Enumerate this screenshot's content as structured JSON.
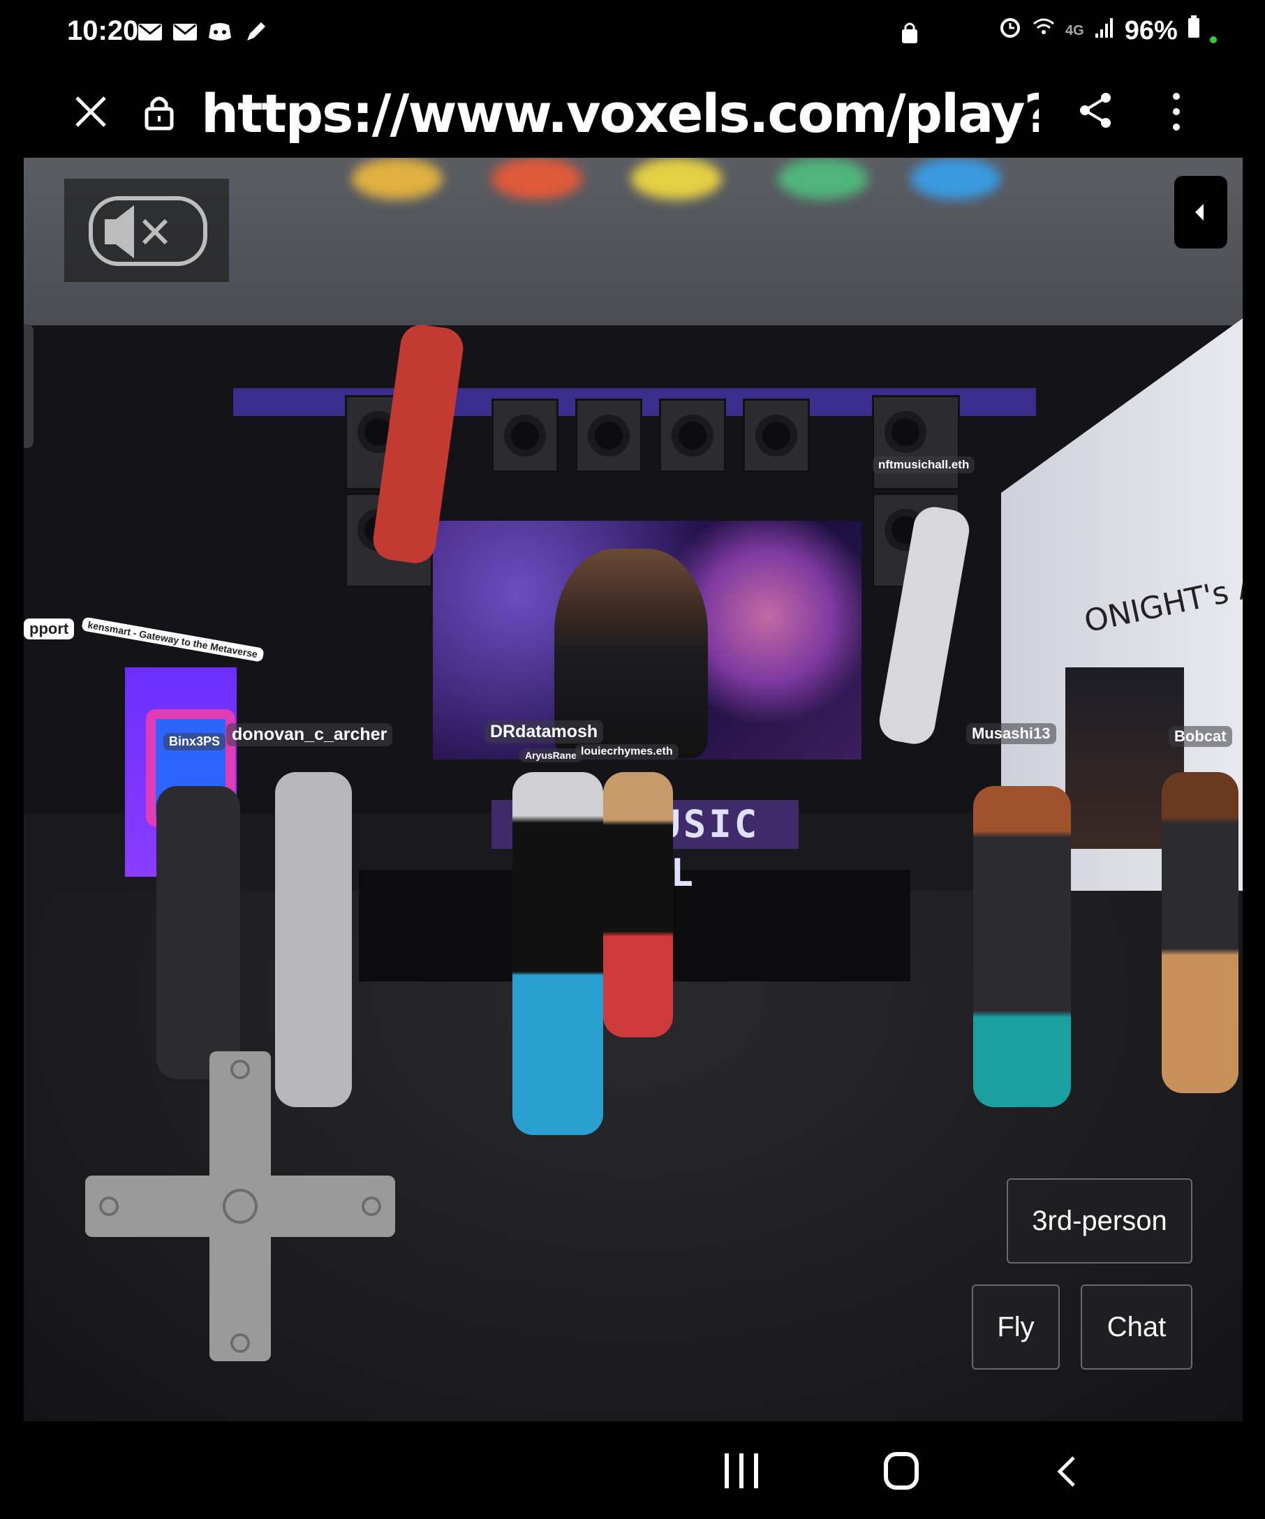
{
  "status_bar": {
    "time": "10:20",
    "notification_icons": [
      "mail-icon",
      "mail-icon",
      "discord-icon",
      "pen-icon"
    ],
    "network": "4G",
    "battery": "96%"
  },
  "address_bar": {
    "url": "https://www.voxels.com/play?coord..."
  },
  "scene": {
    "stage_sign": "NFT MUSIC HALL",
    "right_wall_sign": "ONIGHT's AR",
    "nametags": {
      "nftmusichall": "nftmusichall.eth",
      "binx": "Binx3PS",
      "donovan": "donovan_c_archer",
      "drdatamosh": "DRdatamosh",
      "aryus": "AryusRane",
      "louie": "louiecrhymes.eth",
      "musashi": "Musashi13",
      "bobcat": "Bobcat"
    },
    "left_sign_text": "kensmart - Gateway to the Metaverse",
    "left_support_text": "pport"
  },
  "controls": {
    "third_person": "3rd-person",
    "fly": "Fly",
    "chat": "Chat"
  },
  "colors": {
    "accent_purple": "#3a2d8c",
    "sign_magenta": "#e23cb5"
  }
}
